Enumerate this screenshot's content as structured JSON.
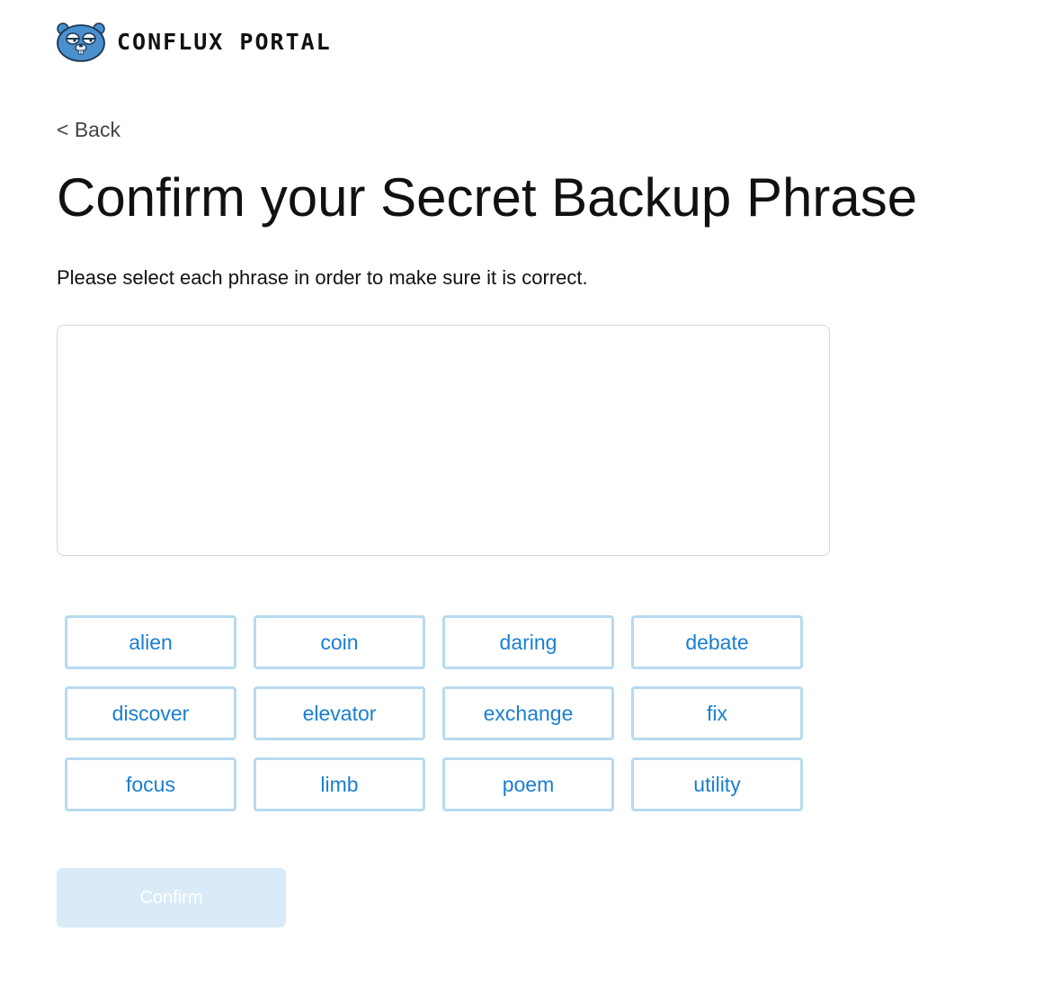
{
  "header": {
    "brand": "CONFLUX PORTAL",
    "logo_icon": "gopher-logo-icon"
  },
  "nav": {
    "back_label": "< Back"
  },
  "main": {
    "title": "Confirm your Secret Backup Phrase",
    "subtitle": "Please select each phrase in order to make sure it is correct.",
    "selected_words": []
  },
  "words": [
    "alien",
    "coin",
    "daring",
    "debate",
    "discover",
    "elevator",
    "exchange",
    "fix",
    "focus",
    "limb",
    "poem",
    "utility"
  ],
  "actions": {
    "confirm_label": "Confirm",
    "confirm_enabled": false
  },
  "colors": {
    "word_text": "#1a7fd1",
    "word_border": "#b7daf0",
    "confirm_bg_disabled": "#d9ebf8",
    "logo_blue": "#4a8fce"
  }
}
